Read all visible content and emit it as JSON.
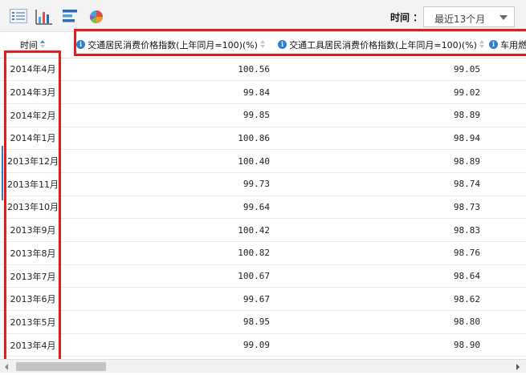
{
  "toolbar": {
    "icons": [
      "table-view-icon",
      "bar-chart-icon",
      "horizontal-bar-icon",
      "pie-chart-icon"
    ],
    "time_label": "时间 ：",
    "time_select_value": "最近13个月"
  },
  "table": {
    "columns": [
      {
        "label": "时间",
        "info": false,
        "sort": "asc"
      },
      {
        "label": "交通居民消费价格指数(上年同月=100)(%)",
        "info": true,
        "sort": "none"
      },
      {
        "label": "交通工具居民消费价格指数(上年同月=100)(%)",
        "info": true,
        "sort": "none"
      },
      {
        "label": "车用燃料",
        "info": true,
        "sort": "none"
      }
    ],
    "rows": [
      {
        "date": "2014年4月",
        "v1": "100.56",
        "v2": "99.05"
      },
      {
        "date": "2014年3月",
        "v1": "99.84",
        "v2": "99.02"
      },
      {
        "date": "2014年2月",
        "v1": "99.85",
        "v2": "98.89"
      },
      {
        "date": "2014年1月",
        "v1": "100.86",
        "v2": "98.94"
      },
      {
        "date": "2013年12月",
        "v1": "100.40",
        "v2": "98.89"
      },
      {
        "date": "2013年11月",
        "v1": "99.73",
        "v2": "98.74"
      },
      {
        "date": "2013年10月",
        "v1": "99.64",
        "v2": "98.73"
      },
      {
        "date": "2013年9月",
        "v1": "100.42",
        "v2": "98.83"
      },
      {
        "date": "2013年8月",
        "v1": "100.82",
        "v2": "98.76"
      },
      {
        "date": "2013年7月",
        "v1": "100.67",
        "v2": "98.64"
      },
      {
        "date": "2013年6月",
        "v1": "99.67",
        "v2": "98.62"
      },
      {
        "date": "2013年5月",
        "v1": "98.95",
        "v2": "98.80"
      },
      {
        "date": "2013年4月",
        "v1": "99.09",
        "v2": "98.90"
      }
    ]
  },
  "colors": {
    "highlight": "#e21f1f",
    "info_icon": "#2f7fd1",
    "sort_active": "#3d8fe0"
  }
}
